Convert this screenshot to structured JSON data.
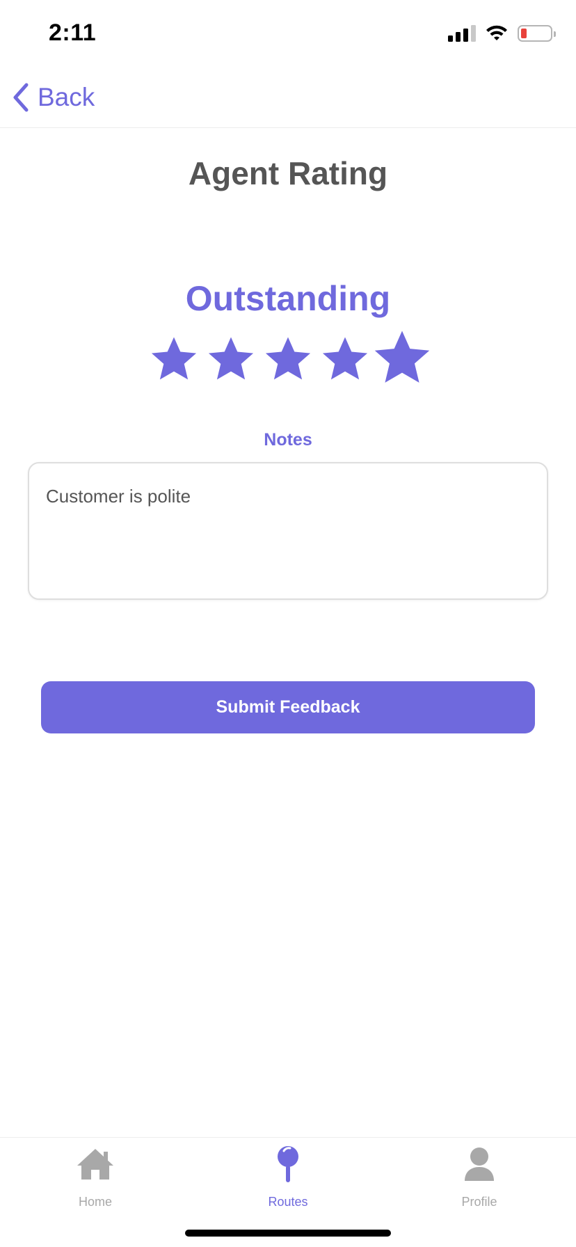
{
  "status_bar": {
    "time": "2:11"
  },
  "nav": {
    "back_label": "Back"
  },
  "page": {
    "title": "Agent Rating"
  },
  "rating": {
    "label": "Outstanding",
    "value": 5,
    "max": 5,
    "color": "#6f69dd"
  },
  "notes": {
    "label": "Notes",
    "value": "Customer is polite"
  },
  "actions": {
    "submit_label": "Submit Feedback"
  },
  "tab_bar": {
    "tabs": [
      {
        "label": "Home",
        "icon": "house-icon",
        "active": false
      },
      {
        "label": "Routes",
        "icon": "map-pin-icon",
        "active": true
      },
      {
        "label": "Profile",
        "icon": "person-icon",
        "active": false
      }
    ],
    "active_color": "#6f69dd",
    "inactive_color": "#a8a8a8"
  }
}
